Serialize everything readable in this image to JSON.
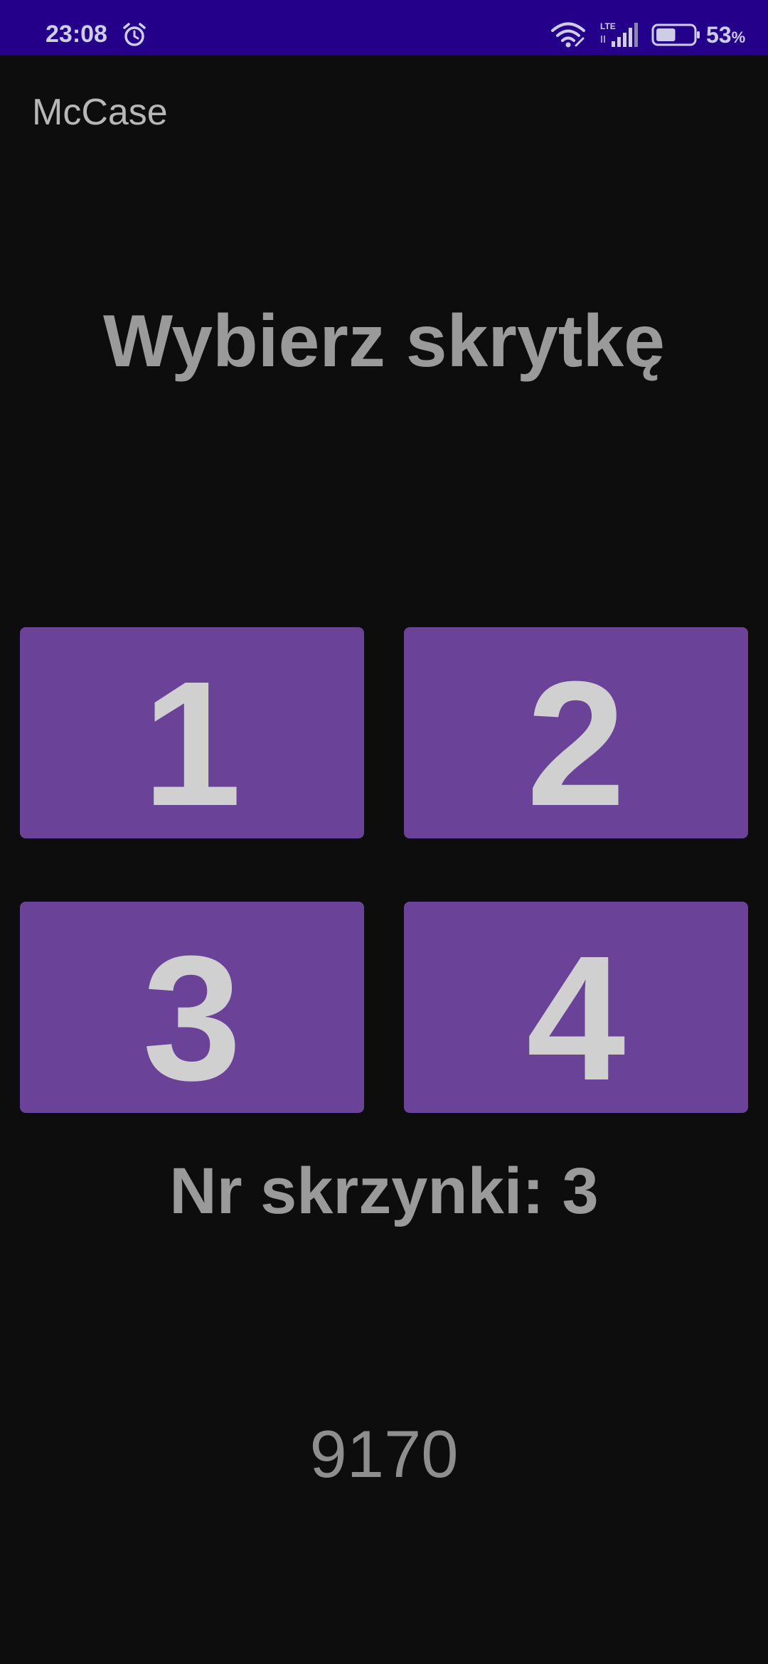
{
  "status_bar": {
    "time": "23:08",
    "network": "LTE",
    "battery_value": "53",
    "battery_unit": "%",
    "battery_level": 0.53,
    "icons": [
      "alarm-icon",
      "wifi-icon",
      "signal-icon",
      "battery-icon"
    ]
  },
  "app": {
    "title": "McCase"
  },
  "main": {
    "heading": "Wybierz skrytkę",
    "lockers": [
      "1",
      "2",
      "3",
      "4"
    ],
    "box_number": "Nr skrzynki: 3",
    "code": "9170"
  },
  "colors": {
    "status_bar": "#24008a",
    "background": "#0d0d0d",
    "locker": "#6a4399",
    "locker_text": "#d0d0d0",
    "text": "#9a9a9a"
  }
}
